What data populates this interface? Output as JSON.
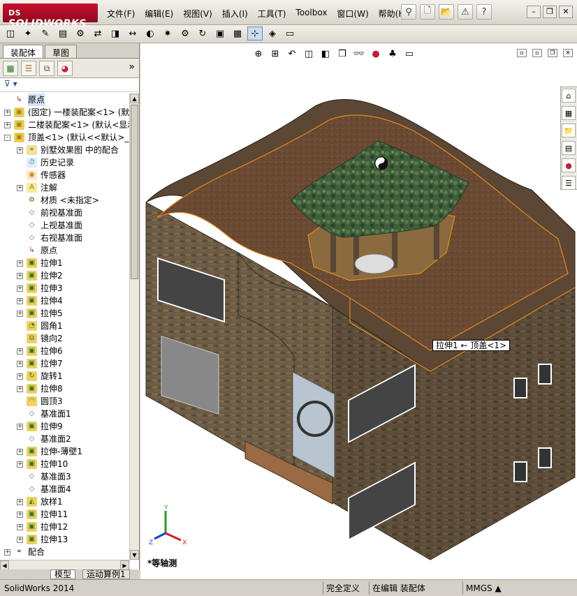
{
  "app": {
    "brand": "SOLIDWORKS",
    "brand_prefix": "DS"
  },
  "menus": [
    "文件(F)",
    "编辑(E)",
    "视图(V)",
    "插入(I)",
    "工具(T)",
    "Toolbox",
    "窗口(W)",
    "帮助(H)"
  ],
  "top_icons": [
    "pin-icon",
    "new-document-icon",
    "open-icon",
    "warning-icon",
    "help-icon"
  ],
  "window_buttons": {
    "minimize": "–",
    "restore": "❐",
    "close": "✕"
  },
  "toolbar_icons": [
    "cube-icon",
    "insert-icon",
    "link-icon",
    "sheet-icon",
    "mate-icon",
    "smart-icon",
    "view-icon",
    "move-icon",
    "display-icon",
    "explode-icon",
    "settings-icon",
    "spin-icon",
    "assembly-icon",
    "pattern-icon",
    "snap-icon",
    "show-icon",
    "grid-icon"
  ],
  "left_panel": {
    "tabs": [
      "装配体",
      "草图"
    ],
    "active_tab": 0,
    "manager_icons": [
      "featuremanager-icon",
      "propertymanager-icon",
      "configurationmanager-icon",
      "appearance-icon"
    ],
    "more_glyph": "»",
    "filter_glyph": "⊽",
    "tree": [
      {
        "depth": 0,
        "exp": "",
        "icon": "origin",
        "label": "原点",
        "selected": true
      },
      {
        "depth": 0,
        "exp": "+",
        "icon": "part",
        "label": "(固定) 一楼装配案<1> (默",
        "selected": false
      },
      {
        "depth": 0,
        "exp": "+",
        "icon": "part",
        "label": "二楼装配案<1> (默认<显示",
        "selected": false
      },
      {
        "depth": 0,
        "exp": "-",
        "icon": "part",
        "label": "顶盖<1> (默认<<默认>_显",
        "selected": false
      },
      {
        "depth": 1,
        "exp": "+",
        "icon": "mate",
        "label": "别墅效果图 中的配合",
        "selected": false
      },
      {
        "depth": 1,
        "exp": "",
        "icon": "history",
        "label": "历史记录",
        "selected": false
      },
      {
        "depth": 1,
        "exp": "",
        "icon": "sensor",
        "label": "传感器",
        "selected": false
      },
      {
        "depth": 1,
        "exp": "+",
        "icon": "note",
        "label": "注解",
        "selected": false
      },
      {
        "depth": 1,
        "exp": "",
        "icon": "material",
        "label": "材质 <未指定>",
        "selected": false
      },
      {
        "depth": 1,
        "exp": "",
        "icon": "plane",
        "label": "前视基准面",
        "selected": false
      },
      {
        "depth": 1,
        "exp": "",
        "icon": "plane",
        "label": "上视基准面",
        "selected": false
      },
      {
        "depth": 1,
        "exp": "",
        "icon": "plane",
        "label": "右视基准面",
        "selected": false
      },
      {
        "depth": 1,
        "exp": "",
        "icon": "origin",
        "label": "原点",
        "selected": false
      },
      {
        "depth": 1,
        "exp": "+",
        "icon": "extrude",
        "label": "拉伸1",
        "selected": false
      },
      {
        "depth": 1,
        "exp": "+",
        "icon": "extrude",
        "label": "拉伸2",
        "selected": false
      },
      {
        "depth": 1,
        "exp": "+",
        "icon": "extrude",
        "label": "拉伸3",
        "selected": false
      },
      {
        "depth": 1,
        "exp": "+",
        "icon": "extrude",
        "label": "拉伸4",
        "selected": false
      },
      {
        "depth": 1,
        "exp": "+",
        "icon": "extrude",
        "label": "拉伸5",
        "selected": false
      },
      {
        "depth": 1,
        "exp": "",
        "icon": "fillet",
        "label": "圆角1",
        "selected": false
      },
      {
        "depth": 1,
        "exp": "",
        "icon": "mirror",
        "label": "镜向2",
        "selected": false
      },
      {
        "depth": 1,
        "exp": "+",
        "icon": "extrude",
        "label": "拉伸6",
        "selected": false
      },
      {
        "depth": 1,
        "exp": "+",
        "icon": "extrude",
        "label": "拉伸7",
        "selected": false
      },
      {
        "depth": 1,
        "exp": "+",
        "icon": "revolve",
        "label": "旋转1",
        "selected": false
      },
      {
        "depth": 1,
        "exp": "+",
        "icon": "extrude",
        "label": "拉伸8",
        "selected": false
      },
      {
        "depth": 1,
        "exp": "",
        "icon": "dome",
        "label": "圆顶3",
        "selected": false
      },
      {
        "depth": 1,
        "exp": "",
        "icon": "plane",
        "label": "基准面1",
        "selected": false
      },
      {
        "depth": 1,
        "exp": "+",
        "icon": "extrude",
        "label": "拉伸9",
        "selected": false
      },
      {
        "depth": 1,
        "exp": "",
        "icon": "plane",
        "label": "基准面2",
        "selected": false
      },
      {
        "depth": 1,
        "exp": "+",
        "icon": "extrude",
        "label": "拉伸-薄壁1",
        "selected": false
      },
      {
        "depth": 1,
        "exp": "+",
        "icon": "extrude",
        "label": "拉伸10",
        "selected": false
      },
      {
        "depth": 1,
        "exp": "",
        "icon": "plane",
        "label": "基准面3",
        "selected": false
      },
      {
        "depth": 1,
        "exp": "",
        "icon": "plane",
        "label": "基准面4",
        "selected": false
      },
      {
        "depth": 1,
        "exp": "+",
        "icon": "loft",
        "label": "放样1",
        "selected": false
      },
      {
        "depth": 1,
        "exp": "+",
        "icon": "extrude",
        "label": "拉伸11",
        "selected": false
      },
      {
        "depth": 1,
        "exp": "+",
        "icon": "extrude",
        "label": "拉伸12",
        "selected": false
      },
      {
        "depth": 1,
        "exp": "+",
        "icon": "extrude",
        "label": "拉伸13",
        "selected": false
      },
      {
        "depth": 0,
        "exp": "+",
        "icon": "mates",
        "label": "配合",
        "selected": false
      }
    ],
    "bottom_tabs": [
      "模型",
      "运动算例1"
    ],
    "active_bottom_tab": 0
  },
  "viewport": {
    "hud_icons": [
      "zoom-to-fit-icon",
      "zoom-area-icon",
      "previous-view-icon",
      "section-view-icon",
      "view-orientation-icon",
      "display-style-icon",
      "hide-show-icon",
      "edit-appearance-icon",
      "scene-icon",
      "view-settings-icon"
    ],
    "hud_right": [
      "tile-icon",
      "tile2-icon",
      "restore-viewport-icon",
      "close-viewport-icon"
    ],
    "taskpane_icons": [
      "home-icon",
      "design-library-icon",
      "file-explorer-icon",
      "view-palette-icon",
      "appearances-icon",
      "custom-properties-icon"
    ],
    "tooltip": "拉伸1 ← 顶盖<1>",
    "view_name": "*等轴测",
    "triad": {
      "x": "X",
      "y": "Y",
      "z": "Z"
    }
  },
  "statusbar": {
    "app_version": "SolidWorks 2014",
    "definition": "完全定义",
    "editing": "在编辑 装配体",
    "units": "MMGS",
    "units_arrow": "▲"
  },
  "colors": {
    "selection_outline": "#e08a1e",
    "roof": "#6b4a34",
    "wall": "#6a5a44",
    "pavilion_roof": "#3f5e3a"
  }
}
